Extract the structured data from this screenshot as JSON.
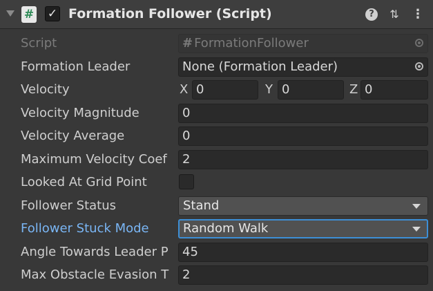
{
  "header": {
    "title": "Formation Follower (Script)",
    "script_icon": "#",
    "enabled_check": "✓",
    "help_icon": "?",
    "presets_icon": "⇅",
    "more_icon": "⋮"
  },
  "fields": {
    "script": {
      "label": "Script",
      "hash": "#",
      "value": "FormationFollower"
    },
    "formation_leader": {
      "label": "Formation Leader",
      "value": "None (Formation Leader)"
    },
    "velocity": {
      "label": "Velocity",
      "x_label": "X",
      "x": "0",
      "y_label": "Y",
      "y": "0",
      "z_label": "Z",
      "z": "0"
    },
    "velocity_magnitude": {
      "label": "Velocity Magnitude",
      "value": "0"
    },
    "velocity_average": {
      "label": "Velocity Average",
      "value": "0"
    },
    "max_velocity_coef": {
      "label": "Maximum Velocity Coef",
      "value": "2"
    },
    "looked_at_grid_point": {
      "label": "Looked At Grid Point",
      "checked": false
    },
    "follower_status": {
      "label": "Follower Status",
      "value": "Stand"
    },
    "follower_stuck_mode": {
      "label": "Follower Stuck Mode",
      "value": "Random Walk"
    },
    "angle_towards_leader": {
      "label": "Angle Towards Leader P",
      "value": "45"
    },
    "max_obstacle_evasion": {
      "label": "Max Obstacle Evasion T",
      "value": "2"
    }
  },
  "colors": {
    "background": "#383838",
    "field_bg": "#2a2a2a",
    "focus_blue": "#3d8fd6",
    "focus_label": "#7ab6f5"
  }
}
